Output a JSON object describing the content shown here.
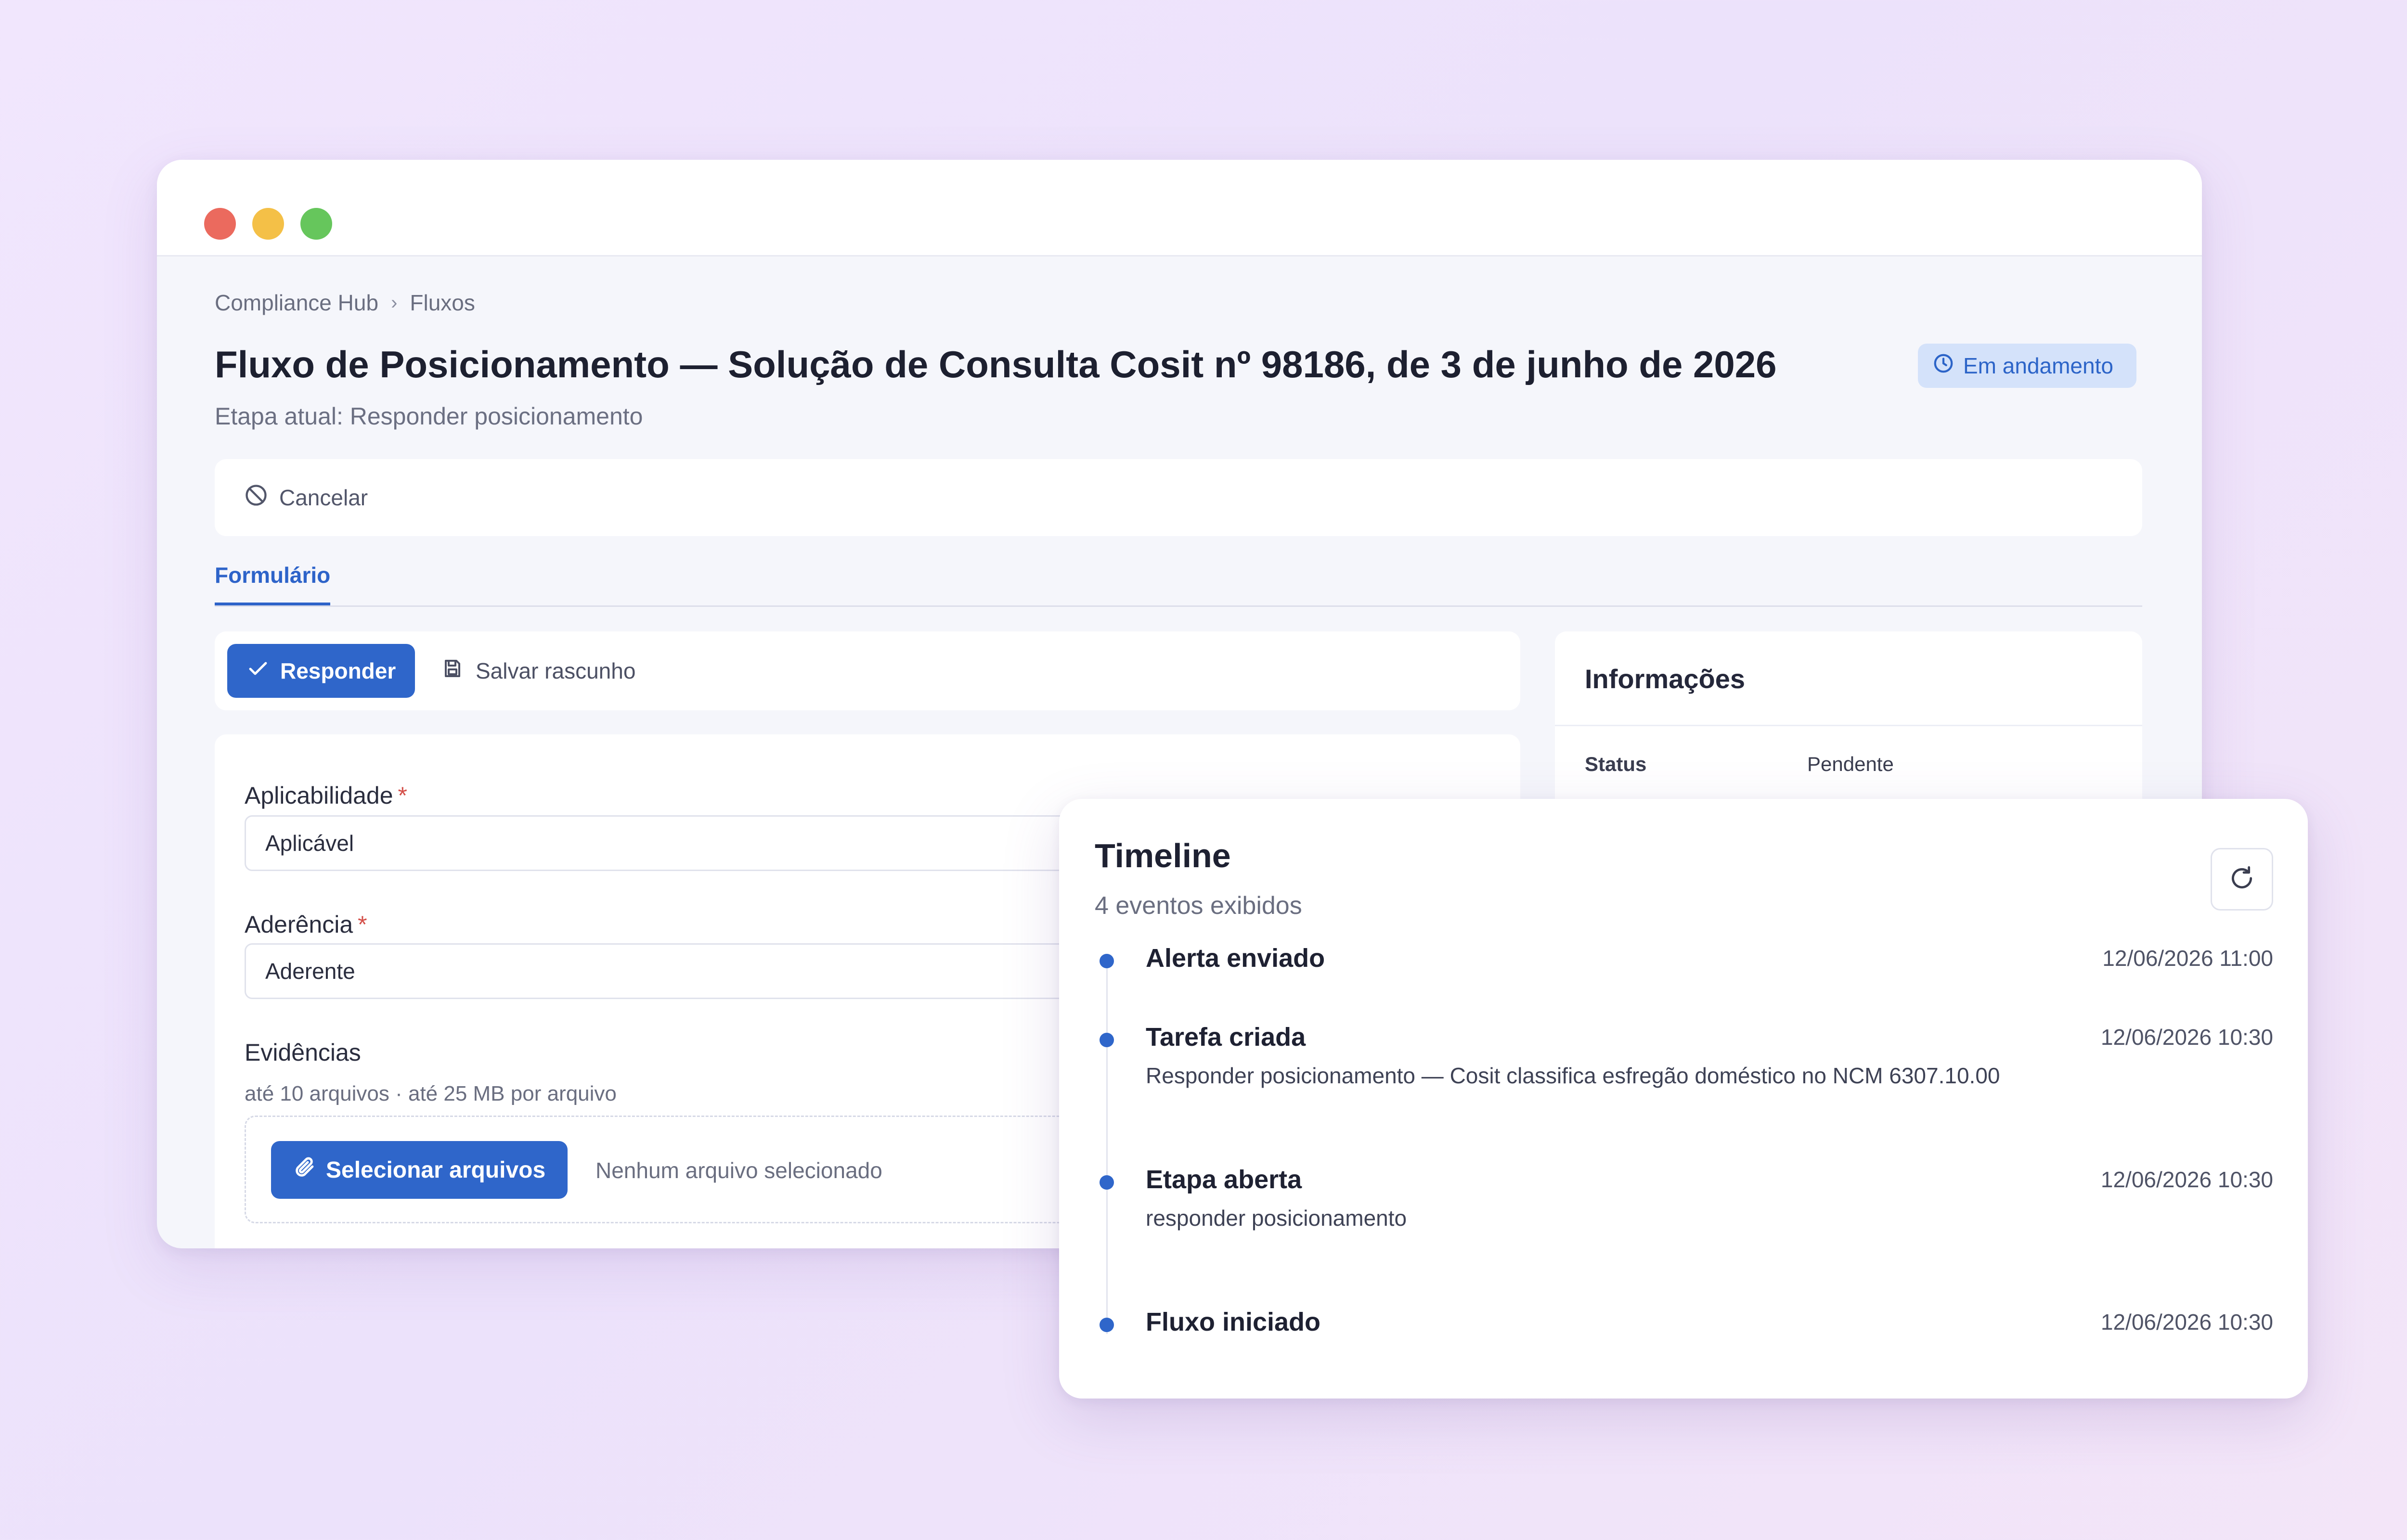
{
  "breadcrumb": {
    "root": "Compliance Hub",
    "separator": "›",
    "current": "Fluxos"
  },
  "page": {
    "title": "Fluxo de Posicionamento — Solução de Consulta Cosit nº 98186, de 3 de junho de 2026",
    "subtitle": "Etapa atual: Responder posicionamento",
    "status": "Em andamento"
  },
  "actions": {
    "cancel": "Cancelar"
  },
  "tabs": [
    {
      "label": "Formulário",
      "active": true
    }
  ],
  "form_toolbar": {
    "respond": "Responder",
    "save_draft": "Salvar rascunho"
  },
  "form": {
    "applicability": {
      "label": "Aplicabilidade",
      "required_mark": "*",
      "value": "Aplicável"
    },
    "adherence": {
      "label": "Aderência",
      "required_mark": "*",
      "value": "Aderente"
    },
    "evidence": {
      "label": "Evidências",
      "hint": "até 10 arquivos · até 25 MB por arquivo",
      "select_button": "Selecionar arquivos",
      "no_file": "Nenhum arquivo selecionado"
    }
  },
  "info": {
    "title": "Informações",
    "rows": [
      {
        "key": "Status",
        "value": "Pendente"
      }
    ]
  },
  "timeline": {
    "title": "Timeline",
    "count": "4 eventos exibidos",
    "events": [
      {
        "name": "Alerta enviado",
        "time": "12/06/2026 11:00",
        "description": ""
      },
      {
        "name": "Tarefa criada",
        "time": "12/06/2026 10:30",
        "description": "Responder posicionamento — Cosit classifica esfregão doméstico no NCM 6307.10.00"
      },
      {
        "name": "Etapa aberta",
        "time": "12/06/2026 10:30",
        "description": "responder posicionamento"
      },
      {
        "name": "Fluxo iniciado",
        "time": "12/06/2026 10:30",
        "description": ""
      }
    ]
  },
  "colors": {
    "accent": "#2f66ca",
    "badge_bg": "#d4e2fa",
    "required": "#d4504a",
    "traffic_red": "#eb6a5e",
    "traffic_yellow": "#f4c047",
    "traffic_green": "#66c65c"
  },
  "icons": {
    "status": "clock-icon",
    "cancel": "ban-icon",
    "respond": "check-icon",
    "save_draft": "floppy-disk-icon",
    "select_files": "paperclip-icon",
    "refresh": "refresh-icon"
  }
}
